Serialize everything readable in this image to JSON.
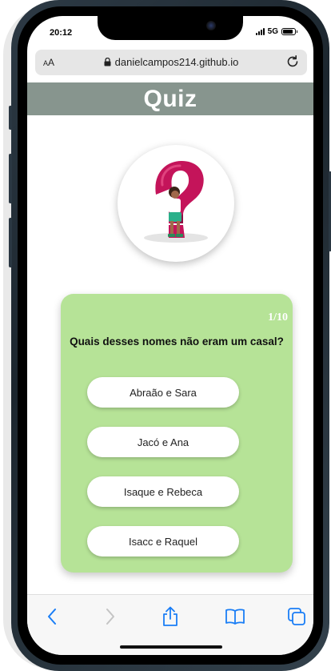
{
  "status_bar": {
    "time": "20:12",
    "network": "5G",
    "battery_level": 0.85
  },
  "browser": {
    "text_size_label": "AA",
    "url": "danielcampos214.github.io"
  },
  "page": {
    "title": "Quiz"
  },
  "quiz": {
    "counter": "1/10",
    "question": "Quais desses nomes não eram um casal?",
    "answers": [
      "Abraão e Sara",
      "Jacó e Ana",
      "Isaque e Rebeca",
      "Isacc e Raquel"
    ]
  },
  "colors": {
    "header_bg": "#87958e",
    "card_bg": "#b6e397",
    "toolbar_accent": "#1a7ef6",
    "toolbar_disabled": "#c4c4c4"
  },
  "icons": {
    "back": "chevron-left-icon",
    "forward": "chevron-right-icon",
    "share": "share-icon",
    "bookmarks": "book-icon",
    "tabs": "tabs-icon",
    "lock": "lock-icon",
    "reload": "reload-icon"
  }
}
